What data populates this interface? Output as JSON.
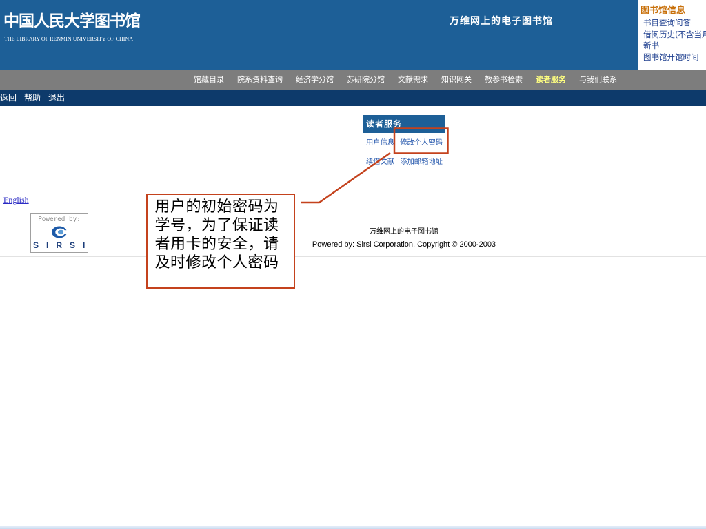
{
  "colors": {
    "banner": "#1d5f97",
    "nav_bar": "#7d7d7d",
    "tool_bar": "#0d3a6b",
    "nav_active": "#ffff80",
    "info_title": "#c8700a",
    "info_link": "#1e3f8f",
    "link": "#2356ac",
    "lang_link": "#2b2bc4",
    "sirsi_brand": "#1b3d7a",
    "callout": "#c4421d"
  },
  "header": {
    "logo_cn": "中国人民大学图书馆",
    "logo_en": "THE LIBRARY OF RENMIN UNIVERSITY OF CHINA",
    "tagline": "万维网上的电子图书馆"
  },
  "info_panel": {
    "title": "图书馆信息",
    "links": [
      {
        "label": "书目查询问答"
      },
      {
        "label": "借阅历史(不含当月)"
      },
      {
        "label": "新书"
      },
      {
        "label": "图书馆开馆时间"
      }
    ]
  },
  "nav": {
    "items": [
      {
        "label": "馆藏目录"
      },
      {
        "label": "院系资料查询"
      },
      {
        "label": "经济学分馆"
      },
      {
        "label": "苏研院分馆"
      },
      {
        "label": "文献需求"
      },
      {
        "label": "知识网关"
      },
      {
        "label": "教参书检索"
      },
      {
        "label": "读者服务",
        "active": true
      },
      {
        "label": "与我们联系"
      }
    ]
  },
  "toolbar": {
    "items": [
      {
        "label": "返回"
      },
      {
        "label": "帮助"
      },
      {
        "label": "退出"
      }
    ]
  },
  "reader_service": {
    "title": "读者服务",
    "links": [
      {
        "label": "用户信息"
      },
      {
        "label": "修改个人密码"
      },
      {
        "label": "续借文献"
      },
      {
        "label": "添加邮箱地址"
      }
    ]
  },
  "language_link": {
    "label": "English"
  },
  "sirsi_logo": {
    "powered_by": "Powered by:",
    "brand": "SIRSI",
    "icon": "sirsi-swirl-icon"
  },
  "footer": {
    "site_name": "万维网上的电子图书馆",
    "copyright": "Powered by: Sirsi Corporation, Copyright © 2000-2003"
  },
  "callout": {
    "lines": [
      "用户的初始密码为",
      "学号，为了保证读",
      "者用卡的安全，请",
      "及时修改个人密码"
    ]
  }
}
